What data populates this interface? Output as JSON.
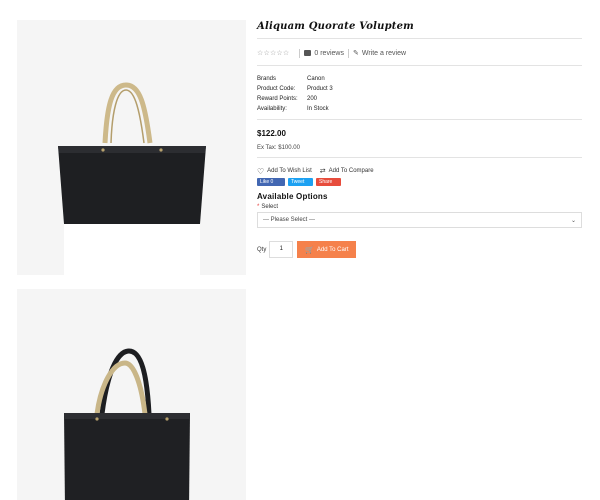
{
  "product": {
    "title": "Aliquam Quorate Voluptem",
    "stars_display": "☆☆☆☆☆",
    "rating": 0,
    "reviews_label": "0 reviews",
    "write_review_label": "Write a review",
    "specs": [
      {
        "label": "Brands",
        "value": "Canon"
      },
      {
        "label": "Product Code:",
        "value": "Product 3"
      },
      {
        "label": "Reward Points:",
        "value": "200"
      },
      {
        "label": "Availability:",
        "value": "In Stock"
      }
    ],
    "price": "$122.00",
    "ex_tax": "Ex Tax: $100.00"
  },
  "actions": {
    "wishlist_label": "Add To Wish List",
    "compare_label": "Add To Compare"
  },
  "social": {
    "like_label": "Like 0",
    "tweet_label": "Tweet",
    "share_label": "Share"
  },
  "options": {
    "title": "Available Options",
    "required_mark": "*",
    "select_label": "Select",
    "select_value": "--- Please Select ---"
  },
  "cart": {
    "qty_label": "Qty",
    "qty_value": "1",
    "button_label": "Add To Cart"
  },
  "colors": {
    "accent": "#f5814b",
    "required": "#e53935",
    "facebook": "#4267b2",
    "twitter": "#1da1f2",
    "share": "#e74c3c"
  },
  "icons": {
    "review": "speech-bubble-icon",
    "write": "pencil-icon",
    "wishlist": "heart-icon",
    "compare": "compare-arrows-icon",
    "dropdown": "chevron-down-icon",
    "cart": "cart-icon"
  }
}
